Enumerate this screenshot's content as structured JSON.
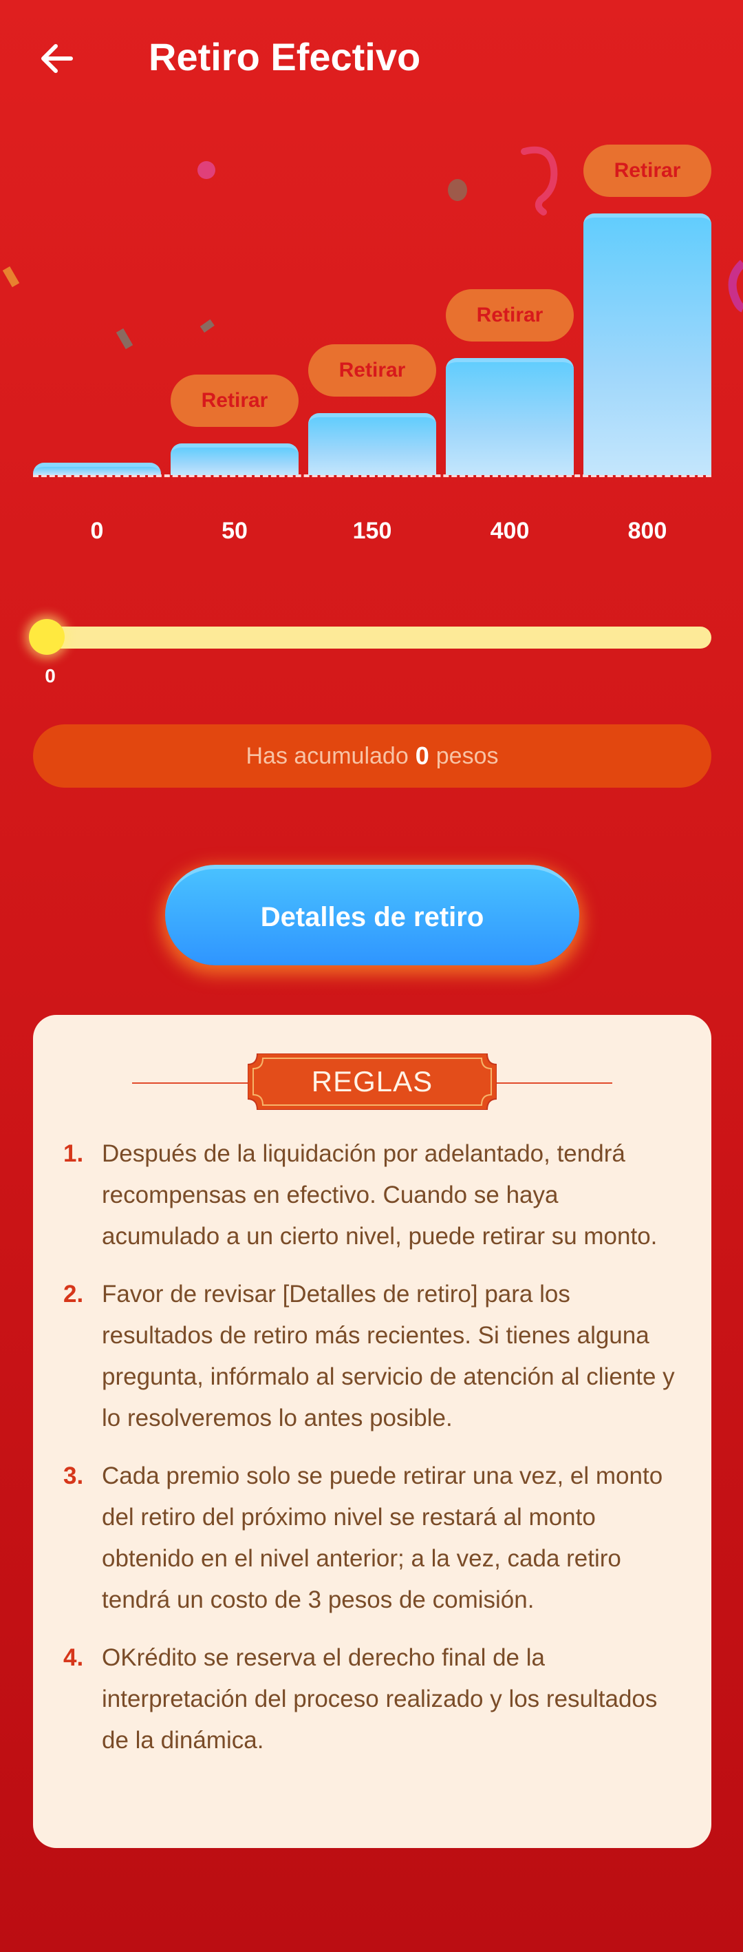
{
  "header": {
    "title": "Retiro Efectivo",
    "back_icon": "arrow-left-icon"
  },
  "colors": {
    "background": "#d51a1c",
    "bar": "#62cdfd",
    "withdraw_button": "#e8712f",
    "withdraw_text": "#d7191c",
    "accent_orange": "#e2470f",
    "details_button": "#2f95ff",
    "slider_track": "#fdea98",
    "card": "#fdefe1",
    "rule_text": "#7a4c28"
  },
  "chart_data": {
    "type": "bar",
    "categories": [
      "0",
      "50",
      "150",
      "400",
      "800"
    ],
    "values": [
      0,
      50,
      150,
      400,
      800
    ],
    "button_label": "Retirar"
  },
  "tiers": [
    {
      "label": "0",
      "has_button": false
    },
    {
      "label": "50",
      "button_label": "Retirar",
      "has_button": true
    },
    {
      "label": "150",
      "button_label": "Retirar",
      "has_button": true
    },
    {
      "label": "400",
      "button_label": "Retirar",
      "has_button": true
    },
    {
      "label": "800",
      "button_label": "Retirar",
      "has_button": true
    }
  ],
  "progress": {
    "value": 0,
    "label": "0"
  },
  "accumulated": {
    "prefix": "Has acumulado",
    "amount": "0",
    "suffix": "pesos"
  },
  "details_button": {
    "label": "Detalles de retiro"
  },
  "rules": {
    "title": "REGLAS",
    "items": [
      {
        "num": "1.",
        "text": "Después de la liquidación por adelantado, tendrá recompensas en efectivo. Cuando se haya acumulado a un cierto nivel, puede retirar su monto."
      },
      {
        "num": "2.",
        "text": "Favor de revisar [Detalles de retiro] para los resultados de retiro más recientes. Si tienes alguna pregunta, infórmalo al servicio de atención al cliente y lo resolveremos lo antes posible."
      },
      {
        "num": "3.",
        "text": "Cada premio solo se puede retirar una vez, el monto del retiro del próximo nivel se restará al monto obtenido en el nivel anterior; a la vez, cada retiro tendrá un costo de 3 pesos de comisión."
      },
      {
        "num": "4.",
        "text": "OKrédito se reserva el derecho final de la interpretación del proceso realizado y los resultados de la dinámica."
      }
    ]
  }
}
